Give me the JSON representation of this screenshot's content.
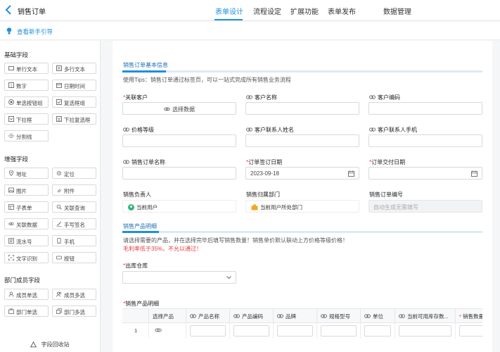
{
  "header": {
    "title": "销售订单",
    "tabs": [
      {
        "label": "表单设计",
        "active": true
      },
      {
        "label": "流程设定",
        "active": false
      },
      {
        "label": "扩展功能",
        "active": false
      },
      {
        "label": "表单发布",
        "active": false
      },
      {
        "label": "数据管理",
        "active": false
      }
    ]
  },
  "guide": {
    "link": "查看新手引导"
  },
  "sidebar": {
    "basic_title": "基础字段",
    "basic": [
      {
        "label": "单行文本",
        "icon": "single-line-icon"
      },
      {
        "label": "多行文本",
        "icon": "multi-line-icon"
      },
      {
        "label": "数字",
        "icon": "number-icon"
      },
      {
        "label": "日期时间",
        "icon": "calendar-icon"
      },
      {
        "label": "单选按钮组",
        "icon": "radio-icon"
      },
      {
        "label": "复选框组",
        "icon": "checkbox-icon"
      },
      {
        "label": "下拉框",
        "icon": "dropdown-icon"
      },
      {
        "label": "下拉复选框",
        "icon": "dropdown-multi-icon"
      },
      {
        "label": "分割线",
        "icon": "divider-icon"
      }
    ],
    "enhanced_title": "增强字段",
    "enhanced": [
      {
        "label": "地址",
        "icon": "location-pin-icon"
      },
      {
        "label": "定位",
        "icon": "locate-icon"
      },
      {
        "label": "图片",
        "icon": "image-icon"
      },
      {
        "label": "附件",
        "icon": "attachment-icon"
      },
      {
        "label": "子表单",
        "icon": "subform-icon"
      },
      {
        "label": "关联查询",
        "icon": "link-query-icon"
      },
      {
        "label": "关联数据",
        "icon": "link-data-icon"
      },
      {
        "label": "手写签名",
        "icon": "signature-icon"
      },
      {
        "label": "流水号",
        "icon": "serial-icon"
      },
      {
        "label": "手机",
        "icon": "phone-icon"
      },
      {
        "label": "文字识别",
        "icon": "ocr-icon"
      },
      {
        "label": "按钮",
        "icon": "button-icon"
      }
    ],
    "member_title": "部门成员字段",
    "member": [
      {
        "label": "成员单选",
        "icon": "user-icon"
      },
      {
        "label": "成员多选",
        "icon": "users-icon"
      },
      {
        "label": "部门单选",
        "icon": "dept-icon"
      },
      {
        "label": "部门多选",
        "icon": "depts-icon"
      }
    ],
    "recycle": "字段回收站"
  },
  "form": {
    "section1_title": "销售订单基本信息",
    "tips": "使用Tips：销售订单通过标签页，可以一站式完成所有销售业务流程",
    "fields": {
      "customer": {
        "label": "关联客户",
        "required": true,
        "button": "选择数据"
      },
      "customer_name": {
        "label": "客户名称"
      },
      "customer_code": {
        "label": "客户编码"
      },
      "price_level": {
        "label": "价格等级"
      },
      "contact_name": {
        "label": "客户联系人姓名"
      },
      "contact_phone": {
        "label": "客户联系人手机"
      },
      "order_name": {
        "label": "销售订单名称"
      },
      "sign_date": {
        "label": "订单签订日期",
        "required": true,
        "value": "2023-09-18"
      },
      "delivery_date": {
        "label": "订单交付日期",
        "required": true
      },
      "owner": {
        "label": "销售负责人",
        "value": "当前用户"
      },
      "dept": {
        "label": "销售归属部门",
        "value": "当前用户所处部门"
      },
      "order_no": {
        "label": "销售订单编号",
        "placeholder": "自动生成无需填写"
      }
    },
    "section2_title": "销售产品明细",
    "note": "请选择需要的产品，并在选择完毕后填写销售数量！销售单价默认联动上方价格等级价格！",
    "red_note": "毛利率低于35%，不允以通过！",
    "warehouse": {
      "label": "出库仓库",
      "required": true
    },
    "detail": {
      "label": "销售产品明细",
      "required": true,
      "columns": [
        "选择产品",
        "产品名称",
        "产品编码",
        "品牌",
        "规格型号",
        "单位",
        "当前可用库存数...",
        "销售数量"
      ],
      "row_index": "1"
    }
  }
}
